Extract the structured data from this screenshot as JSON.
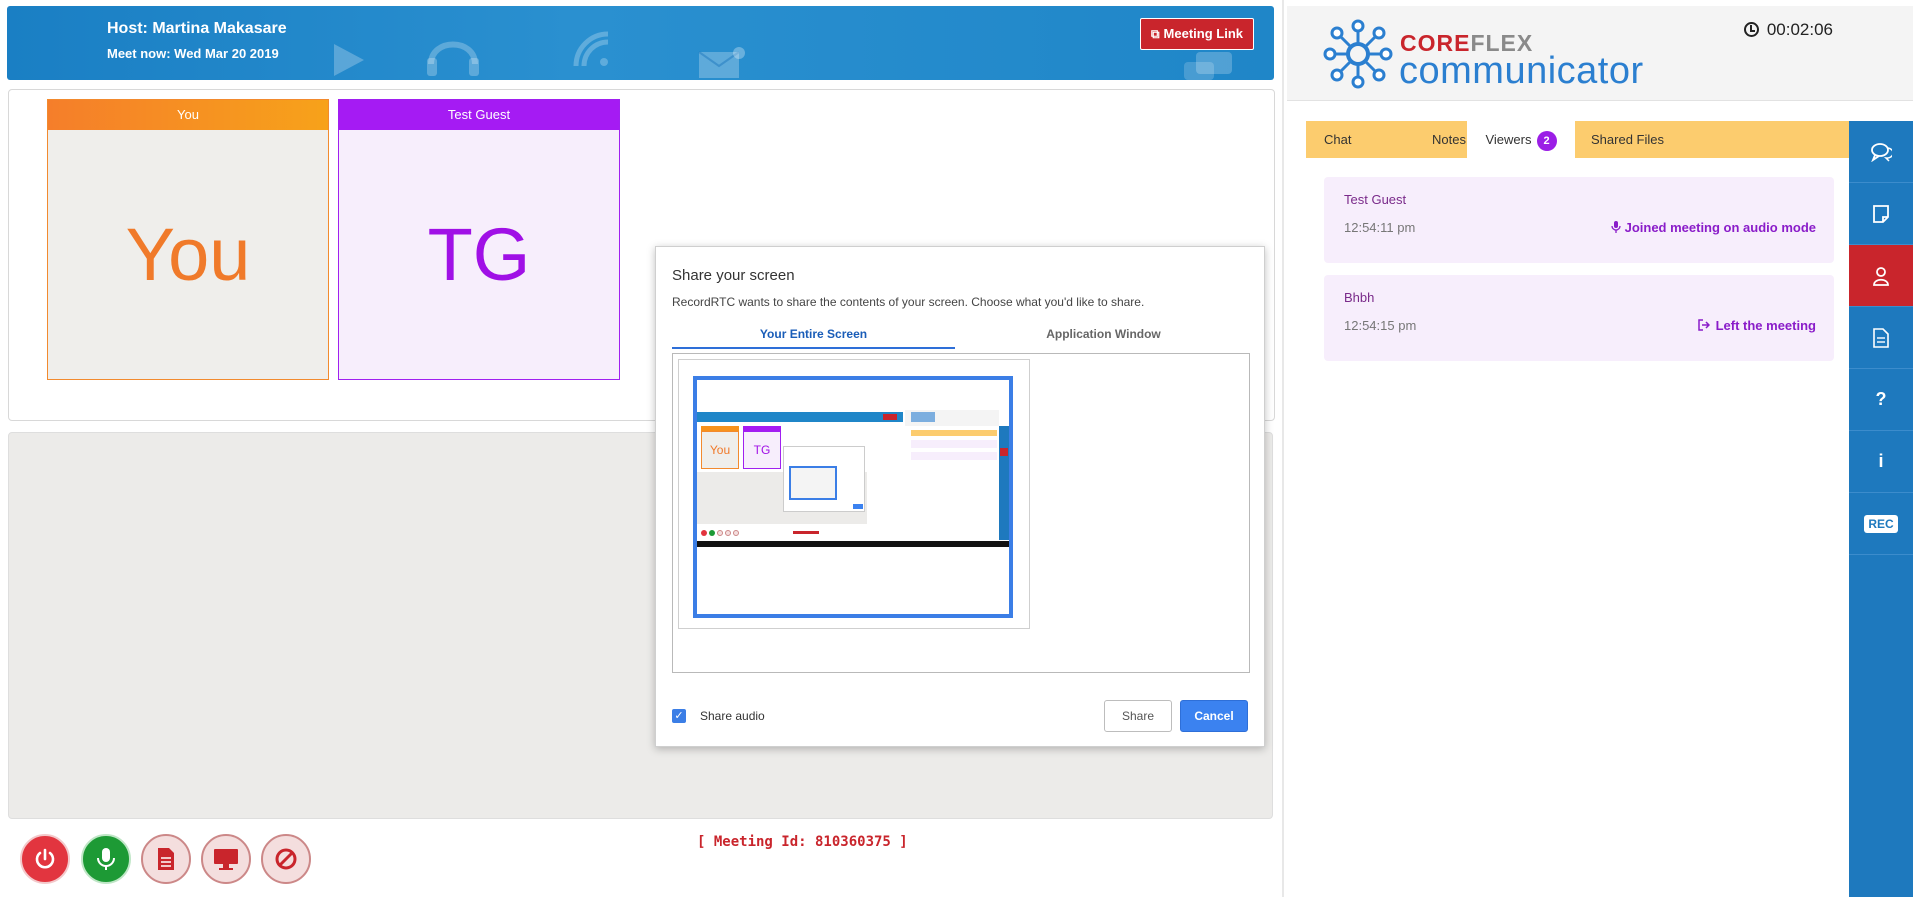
{
  "header": {
    "host": "Host: Martina Makasare",
    "meet_now": "Meet now: Wed Mar 20 2019",
    "meeting_link_label": "Meeting Link"
  },
  "participants": [
    {
      "header": "You",
      "initials": "You"
    },
    {
      "header": "Test Guest",
      "initials": "TG"
    }
  ],
  "controls": {
    "meeting_id": "[ Meeting Id: 810360375 ]",
    "buttons": [
      "power-icon",
      "microphone-icon",
      "document-icon",
      "monitor-icon",
      "block-icon"
    ]
  },
  "share_dialog": {
    "title": "Share your screen",
    "description": "RecordRTC wants to share the contents of your screen. Choose what you'd like to share.",
    "tabs": [
      "Your Entire Screen",
      "Application Window"
    ],
    "selected_tab": "Your Entire Screen",
    "thumbnail": {
      "you_label": "You",
      "tg_label": "TG"
    },
    "share_audio_label": "Share audio",
    "share_audio_checked": true,
    "share_button": "Share",
    "cancel_button": "Cancel"
  },
  "brand": {
    "core": "CORE",
    "flex": "FLEX",
    "product": "communicator"
  },
  "timer": "00:02:06",
  "side_tabs": {
    "chat": "Chat",
    "notes": "Notes",
    "viewers": "Viewers",
    "viewers_count": "2",
    "shared_files": "Shared Files"
  },
  "viewers": [
    {
      "name": "Test Guest",
      "time": "12:54:11 pm",
      "status": "Joined meeting on audio mode",
      "status_icon": "microphone-icon"
    },
    {
      "name": "Bhbh",
      "time": "12:54:15 pm",
      "status": "Left the meeting",
      "status_icon": "sign-out-icon"
    }
  ],
  "side_nav": [
    "chat-icon",
    "note-icon",
    "user-icon",
    "file-icon",
    "question-icon",
    "info-icon",
    "REC"
  ],
  "colors": {
    "primary_blue": "#1e79be",
    "accent_red": "#c9252c",
    "purple": "#9b1ee6",
    "orange": "#f57e2a",
    "tab_yellow": "#fccc6e"
  }
}
